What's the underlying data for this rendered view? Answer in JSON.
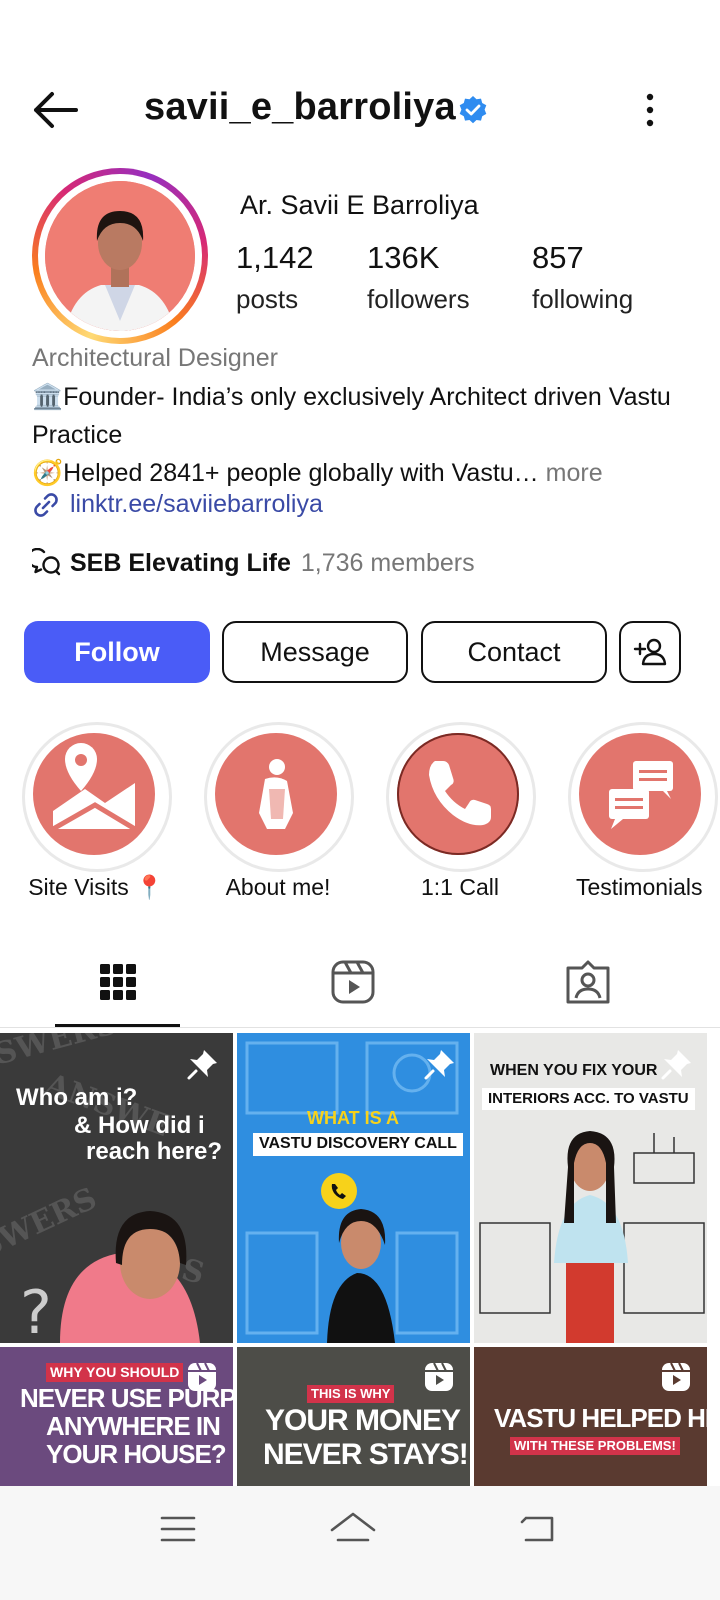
{
  "header": {
    "username": "savii_e_barroliya",
    "back_icon": "arrow-left-icon",
    "verified_icon": "verified-badge-icon",
    "menu_icon": "kebab-menu-icon"
  },
  "profile": {
    "full_name": "Ar. Savii E Barroliya",
    "stats": [
      {
        "value": "1,142",
        "label": "posts"
      },
      {
        "value": "136K",
        "label": "followers"
      },
      {
        "value": "857",
        "label": "following"
      }
    ],
    "category": "Architectural Designer",
    "bio_line1": "🏛️Founder- India’s only exclusively Architect driven Vastu Practice",
    "bio_line2": "🧭Helped 2841+ people globally with Vastu…",
    "bio_more": " more",
    "link": "linktr.ee/saviiebarroliya",
    "channel_name": "SEB Elevating Life",
    "channel_members": "1,736 members"
  },
  "actions": {
    "follow": "Follow",
    "message": "Message",
    "contact": "Contact",
    "add_user_icon": "add-person-icon"
  },
  "highlights": [
    {
      "label": "Site Visits 📍",
      "icon": "map-pin-icon"
    },
    {
      "label": "About me!",
      "icon": "person-icon"
    },
    {
      "label": "1:1 Call",
      "icon": "phone-icon"
    },
    {
      "label": "Testimonials",
      "icon": "chat-bubbles-icon"
    }
  ],
  "tabs": [
    "grid-icon",
    "reels-icon",
    "tagged-icon"
  ],
  "posts": [
    {
      "line1": "Who am i?",
      "line2": "& How did i",
      "line3": "reach here?",
      "pinned": true
    },
    {
      "line1": "WHAT IS A",
      "line2": "VASTU DISCOVERY CALL",
      "pinned": true
    },
    {
      "line1": "WHEN YOU FIX YOUR",
      "line2": "INTERIORS ACC. TO VASTU",
      "pinned": true
    },
    {
      "line1": "WHY YOU SHOULD",
      "line2": "NEVER USE PURPLE",
      "line3": "ANYWHERE IN",
      "line4": "YOUR HOUSE?",
      "reel": true
    },
    {
      "line1": "THIS IS WHY",
      "line2": "YOUR MONEY",
      "line3": "NEVER STAYS!",
      "reel": true
    },
    {
      "line1": "VASTU HELPED HER",
      "line2": "WITH THESE PROBLEMS!",
      "reel": true
    }
  ],
  "colors": {
    "follow_blue": "#4a5cf7",
    "highlight_coral": "#e2756d",
    "link_blue": "#3a4aa6",
    "verified_blue": "#2f8cf0"
  },
  "navbar": [
    "menu-icon",
    "home-icon",
    "back-icon"
  ]
}
